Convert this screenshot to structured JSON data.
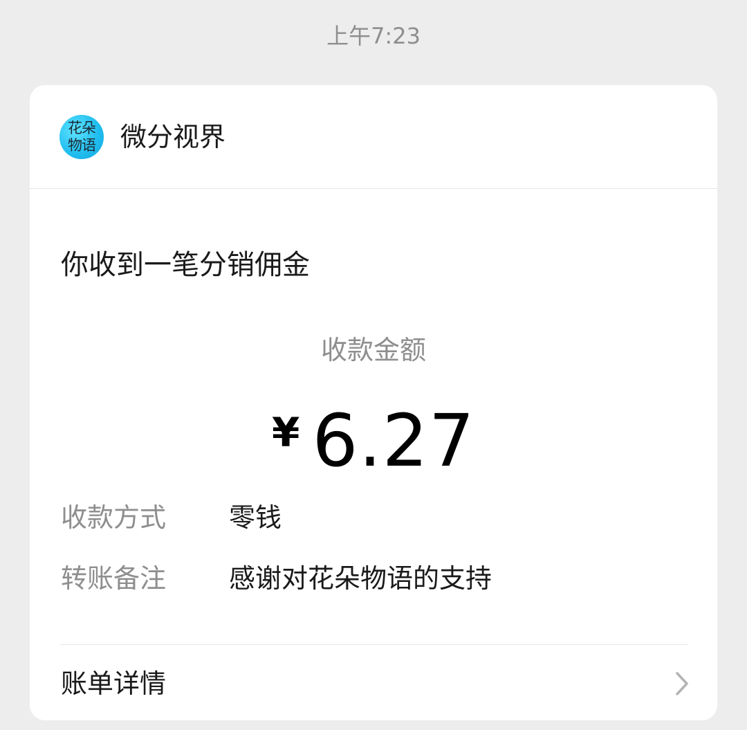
{
  "timestamp": "上午7:23",
  "sender": {
    "avatar_text_line1": "花朵",
    "avatar_text_line2": "物语",
    "name": "微分视界"
  },
  "message": {
    "title": "你收到一笔分销佣金",
    "amount_label": "收款金额",
    "currency_symbol": "¥",
    "amount": "6.27",
    "details": [
      {
        "label": "收款方式",
        "value": "零钱"
      },
      {
        "label": "转账备注",
        "value": "感谢对花朵物语的支持"
      }
    ],
    "bill_details_label": "账单详情"
  },
  "colors": {
    "background": "#ededed",
    "card": "#ffffff",
    "secondary_text": "#8e8e8e",
    "primary_text": "#1a1a1a",
    "avatar": "#22bff0"
  },
  "icons": {
    "chevron": "chevron-right-icon"
  }
}
